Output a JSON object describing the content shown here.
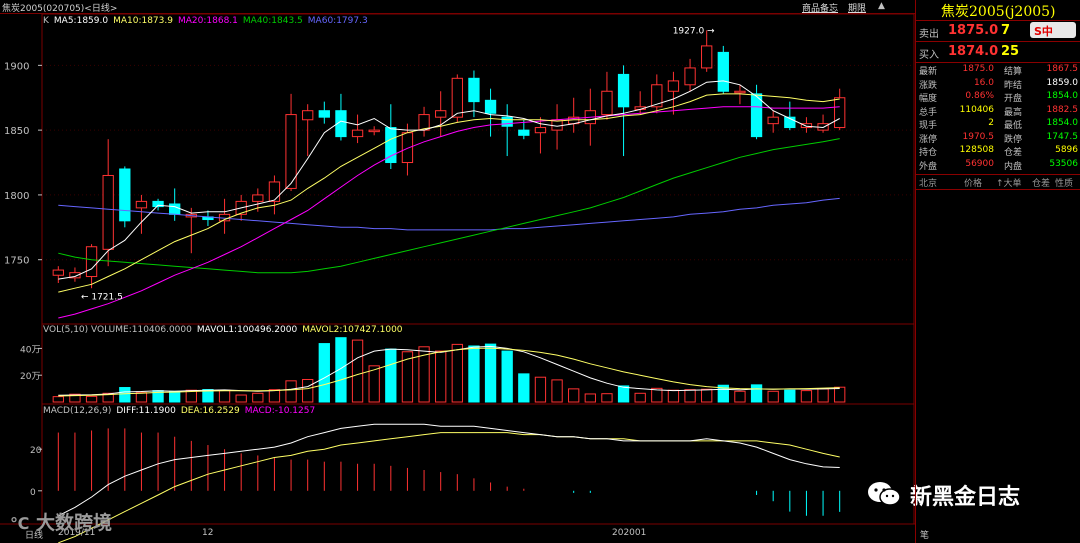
{
  "topbar": {
    "title": "焦炭2005(020705)<日线>",
    "menu": [
      "商品备忘",
      "期限"
    ],
    "up_arrow": "▲"
  },
  "ma_legend": [
    {
      "label": "K",
      "color": "#c0c0c0"
    },
    {
      "label": "MA5:1859.0",
      "color": "#ffffff"
    },
    {
      "label": "MA10:1873.9",
      "color": "#ffff66"
    },
    {
      "label": "MA20:1868.1",
      "color": "#ff00ff"
    },
    {
      "label": "MA40:1843.5",
      "color": "#00cc00"
    },
    {
      "label": "MA60:1797.3",
      "color": "#6666ff"
    }
  ],
  "vol_legend": [
    {
      "label": "VOL(5,10) VOLUME:110406.0000",
      "color": "#c0c0c0"
    },
    {
      "label": "MAVOL1:100496.2000",
      "color": "#ffffff"
    },
    {
      "label": "MAVOL2:107427.1000",
      "color": "#ffff66"
    }
  ],
  "macd_legend": [
    {
      "label": "MACD(12,26,9)",
      "color": "#c0c0c0"
    },
    {
      "label": "DIFF:11.1900",
      "color": "#ffffff"
    },
    {
      "label": "DEA:16.2529",
      "color": "#ffff66"
    },
    {
      "label": "MACD:-10.1257",
      "color": "#ff00ff"
    }
  ],
  "annotations": {
    "high": "1927.0",
    "low": "1721.5"
  },
  "bottom_axis": {
    "label": "日线",
    "ticks": [
      "2019/11",
      "12",
      "202001"
    ]
  },
  "watermarks": {
    "left": "大数跨境",
    "right": "新黑金日志"
  },
  "colors": {
    "up": "#ff3232",
    "down": "#00ffff",
    "grid": "#7a0000"
  },
  "chart_data": {
    "type": "candlestick",
    "y_axis_price": {
      "ticks": [
        1750,
        1800,
        1850,
        1900
      ],
      "range": [
        1705,
        1935
      ]
    },
    "y_axis_volume": {
      "ticks": [
        "20万",
        "40万"
      ],
      "values": [
        200000,
        400000
      ]
    },
    "y_axis_macd": {
      "ticks": [
        0,
        20
      ],
      "range": [
        -15,
        35
      ]
    },
    "candles": [
      [
        1738,
        1742,
        1732,
        1745
      ],
      [
        1736,
        1740,
        1733,
        1744
      ],
      [
        1737,
        1760,
        1728,
        1762
      ],
      [
        1758,
        1815,
        1745,
        1843
      ],
      [
        1820,
        1780,
        1775,
        1822
      ],
      [
        1790,
        1795,
        1770,
        1800
      ],
      [
        1795,
        1791,
        1788,
        1797
      ],
      [
        1793,
        1785,
        1780,
        1805
      ],
      [
        1783,
        1785,
        1755,
        1790
      ],
      [
        1783,
        1781,
        1776,
        1788
      ],
      [
        1780,
        1785,
        1770,
        1797
      ],
      [
        1785,
        1795,
        1780,
        1800
      ],
      [
        1795,
        1800,
        1787,
        1805
      ],
      [
        1795,
        1810,
        1785,
        1815
      ],
      [
        1805,
        1862,
        1803,
        1878
      ],
      [
        1858,
        1865,
        1830,
        1870
      ],
      [
        1865,
        1860,
        1855,
        1872
      ],
      [
        1865,
        1845,
        1842,
        1878
      ],
      [
        1845,
        1850,
        1840,
        1862
      ],
      [
        1850,
        1850,
        1846,
        1853
      ],
      [
        1852,
        1825,
        1820,
        1870
      ],
      [
        1825,
        1848,
        1815,
        1855
      ],
      [
        1850,
        1862,
        1845,
        1868
      ],
      [
        1860,
        1865,
        1845,
        1880
      ],
      [
        1860,
        1890,
        1856,
        1893
      ],
      [
        1890,
        1872,
        1860,
        1896
      ],
      [
        1873,
        1863,
        1845,
        1882
      ],
      [
        1860,
        1853,
        1830,
        1870
      ],
      [
        1850,
        1846,
        1843,
        1858
      ],
      [
        1848,
        1852,
        1832,
        1860
      ],
      [
        1850,
        1858,
        1835,
        1870
      ],
      [
        1855,
        1860,
        1848,
        1875
      ],
      [
        1855,
        1865,
        1838,
        1882
      ],
      [
        1862,
        1880,
        1858,
        1895
      ],
      [
        1893,
        1868,
        1830,
        1900
      ],
      [
        1866,
        1868,
        1862,
        1880
      ],
      [
        1868,
        1885,
        1863,
        1893
      ],
      [
        1880,
        1888,
        1862,
        1895
      ],
      [
        1885,
        1898,
        1880,
        1905
      ],
      [
        1898,
        1915,
        1895,
        1927
      ],
      [
        1910,
        1880,
        1878,
        1915
      ],
      [
        1880,
        1880,
        1870,
        1885
      ],
      [
        1878,
        1845,
        1843,
        1885
      ],
      [
        1855,
        1860,
        1848,
        1865
      ],
      [
        1860,
        1852,
        1850,
        1872
      ],
      [
        1855,
        1852,
        1848,
        1860
      ],
      [
        1850,
        1855,
        1848,
        1862
      ],
      [
        1852,
        1875,
        1850,
        1882
      ]
    ],
    "down_days": [
      4,
      6,
      7,
      9,
      16,
      17,
      20,
      25,
      26,
      27,
      28,
      34,
      40,
      42,
      44
    ],
    "volume": [
      40000,
      58000,
      42000,
      65000,
      108000,
      70000,
      85000,
      80000,
      88000,
      93000,
      88000,
      52000,
      65000,
      92000,
      158000,
      168000,
      436000,
      480000,
      462000,
      270000,
      395000,
      375000,
      412000,
      380000,
      430000,
      418000,
      432000,
      380000,
      210000,
      185000,
      165000,
      98000,
      60000,
      62000,
      120000,
      65000,
      102000,
      88000,
      92000,
      95000,
      125000,
      80000,
      128000,
      80000,
      88000,
      85000,
      98000,
      110406
    ],
    "ma5": [
      1735,
      1737,
      1743,
      1757,
      1765,
      1779,
      1792,
      1791,
      1786,
      1787,
      1787,
      1790,
      1793,
      1796,
      1809,
      1828,
      1848,
      1857,
      1854,
      1859,
      1851,
      1850,
      1850,
      1854,
      1863,
      1865,
      1862,
      1861,
      1859,
      1855,
      1853,
      1855,
      1858,
      1861,
      1863,
      1866,
      1870,
      1874,
      1880,
      1887,
      1888,
      1885,
      1876,
      1865,
      1859,
      1853,
      1852,
      1859
    ],
    "ma10": [
      1725,
      1728,
      1731,
      1737,
      1743,
      1750,
      1757,
      1764,
      1769,
      1774,
      1781,
      1786,
      1790,
      1792,
      1796,
      1805,
      1813,
      1822,
      1829,
      1836,
      1843,
      1848,
      1851,
      1853,
      1856,
      1858,
      1859,
      1858,
      1858,
      1858,
      1857,
      1858,
      1858,
      1859,
      1861,
      1862,
      1865,
      1868,
      1872,
      1877,
      1878,
      1878,
      1877,
      1876,
      1875,
      1873,
      1872,
      1874
    ],
    "ma20": [
      1705,
      1708,
      1712,
      1716,
      1721,
      1726,
      1732,
      1738,
      1743,
      1748,
      1754,
      1760,
      1767,
      1774,
      1781,
      1788,
      1797,
      1806,
      1815,
      1823,
      1830,
      1836,
      1841,
      1845,
      1849,
      1852,
      1854,
      1855,
      1856,
      1857,
      1858,
      1859,
      1860,
      1861,
      1862,
      1863,
      1864,
      1865,
      1866,
      1867,
      1868,
      1868,
      1868,
      1867,
      1867,
      1867,
      1867,
      1868
    ],
    "ma40": [
      1755,
      1752,
      1750,
      1749,
      1748,
      1747,
      1746,
      1745,
      1744,
      1743,
      1742,
      1741,
      1740,
      1740,
      1740,
      1741,
      1743,
      1745,
      1748,
      1751,
      1754,
      1757,
      1760,
      1763,
      1766,
      1769,
      1772,
      1775,
      1778,
      1781,
      1784,
      1787,
      1790,
      1794,
      1798,
      1803,
      1808,
      1813,
      1817,
      1821,
      1825,
      1829,
      1832,
      1835,
      1837,
      1839,
      1841,
      1843.5
    ],
    "ma60": [
      1792,
      1791,
      1790,
      1789,
      1788,
      1787,
      1786,
      1785,
      1784,
      1783,
      1782,
      1781,
      1780,
      1779,
      1778,
      1777,
      1776,
      1775,
      1775,
      1774,
      1774,
      1773,
      1773,
      1773,
      1773,
      1773,
      1773,
      1774,
      1774,
      1775,
      1776,
      1777,
      1778,
      1779,
      1780,
      1781,
      1782,
      1783,
      1785,
      1786,
      1787,
      1789,
      1790,
      1792,
      1793,
      1794,
      1796,
      1797.3
    ],
    "mavol1": [
      50000,
      52000,
      54000,
      60000,
      75000,
      78000,
      84000,
      80000,
      85000,
      88000,
      90000,
      85000,
      80000,
      85000,
      95000,
      115000,
      180000,
      250000,
      330000,
      380000,
      395000,
      390000,
      380000,
      370000,
      390000,
      410000,
      415000,
      400000,
      375000,
      330000,
      280000,
      230000,
      180000,
      140000,
      110000,
      100000,
      90000,
      85000,
      88000,
      90000,
      95000,
      90000,
      98000,
      95000,
      98000,
      96000,
      98000,
      100496
    ],
    "mavol2": [
      45000,
      48000,
      50000,
      55000,
      62000,
      66000,
      72000,
      74000,
      78000,
      82000,
      84000,
      84000,
      84000,
      86000,
      90000,
      100000,
      130000,
      165000,
      205000,
      240000,
      280000,
      320000,
      350000,
      375000,
      390000,
      400000,
      402000,
      395000,
      385000,
      370000,
      350000,
      320000,
      285000,
      255000,
      225000,
      200000,
      175000,
      150000,
      130000,
      115000,
      105000,
      100000,
      98000,
      96000,
      98000,
      100000,
      104000,
      107427
    ],
    "diff": [
      -12,
      -8,
      -3,
      3,
      7,
      10,
      13,
      15,
      16,
      17,
      18,
      19,
      20,
      21,
      23,
      26,
      28,
      30,
      31,
      32,
      32,
      32,
      32,
      31,
      31,
      31,
      30,
      29,
      28,
      27,
      26,
      26,
      25,
      25,
      24,
      24,
      24,
      24,
      24,
      25,
      24,
      23,
      21,
      18,
      15,
      13,
      11.5,
      11.19
    ],
    "dea": [
      -25,
      -22,
      -18,
      -14,
      -10,
      -6,
      -2,
      2,
      5,
      8,
      10,
      12,
      14,
      16,
      17,
      19,
      20,
      22,
      23,
      24,
      25,
      26,
      27,
      28,
      28,
      28,
      28,
      28,
      27,
      27,
      26,
      26,
      25,
      25,
      25,
      24,
      24,
      24,
      24,
      24,
      24,
      24,
      24,
      23,
      22,
      20,
      18,
      16.25
    ],
    "macd": [
      28,
      28,
      29,
      30,
      30,
      28,
      28,
      26,
      24,
      22,
      20,
      18,
      17,
      16,
      15,
      15,
      14,
      14,
      13,
      13,
      12,
      11,
      10,
      9,
      8,
      6,
      4,
      2,
      1,
      0,
      0,
      -1,
      -1,
      0,
      0,
      0,
      0,
      0,
      0,
      0,
      0,
      0,
      -2,
      -5,
      -10,
      -12,
      -12,
      -10.13
    ]
  },
  "quote_panel": {
    "contract": "焦炭2005(j2005)",
    "ask_label": "卖出",
    "ask_price": "1875.0",
    "ask_vol": "7",
    "bid_label": "买入",
    "bid_price": "1874.0",
    "bid_vol": "25",
    "rows": [
      {
        "l1": "最新",
        "v1": "1875.0",
        "c1": "#ff3232",
        "l2": "结算",
        "v2": "1867.5",
        "c2": "#ff3232"
      },
      {
        "l1": "涨跌",
        "v1": "16.0",
        "c1": "#ff3232",
        "l2": "昨结",
        "v2": "1859.0",
        "c2": "#ffffff"
      },
      {
        "l1": "幅度",
        "v1": "0.86%",
        "c1": "#ff3232",
        "l2": "开盘",
        "v2": "1854.0",
        "c2": "#00ff00"
      },
      {
        "l1": "总手",
        "v1": "110406",
        "c1": "#ffff00",
        "l2": "最高",
        "v2": "1882.5",
        "c2": "#ff3232"
      },
      {
        "l1": "现手",
        "v1": "2",
        "c1": "#ffff00",
        "l2": "最低",
        "v2": "1854.0",
        "c2": "#00ff00"
      },
      {
        "l1": "涨停",
        "v1": "1970.5",
        "c1": "#ff3232",
        "l2": "跌停",
        "v2": "1747.5",
        "c2": "#00ff00"
      },
      {
        "l1": "持仓",
        "v1": "128508",
        "c1": "#ffff00",
        "l2": "仓差",
        "v2": "5896",
        "c2": "#ffff00"
      },
      {
        "l1": "外盘",
        "v1": "56900",
        "c1": "#ff3232",
        "l2": "内盘",
        "v2": "53506",
        "c2": "#00ff00"
      }
    ],
    "tabs": [
      "北京",
      "价格",
      "↑大单",
      "仓差",
      "性质"
    ],
    "input_badge": "S中",
    "bottom_char": "笔"
  }
}
